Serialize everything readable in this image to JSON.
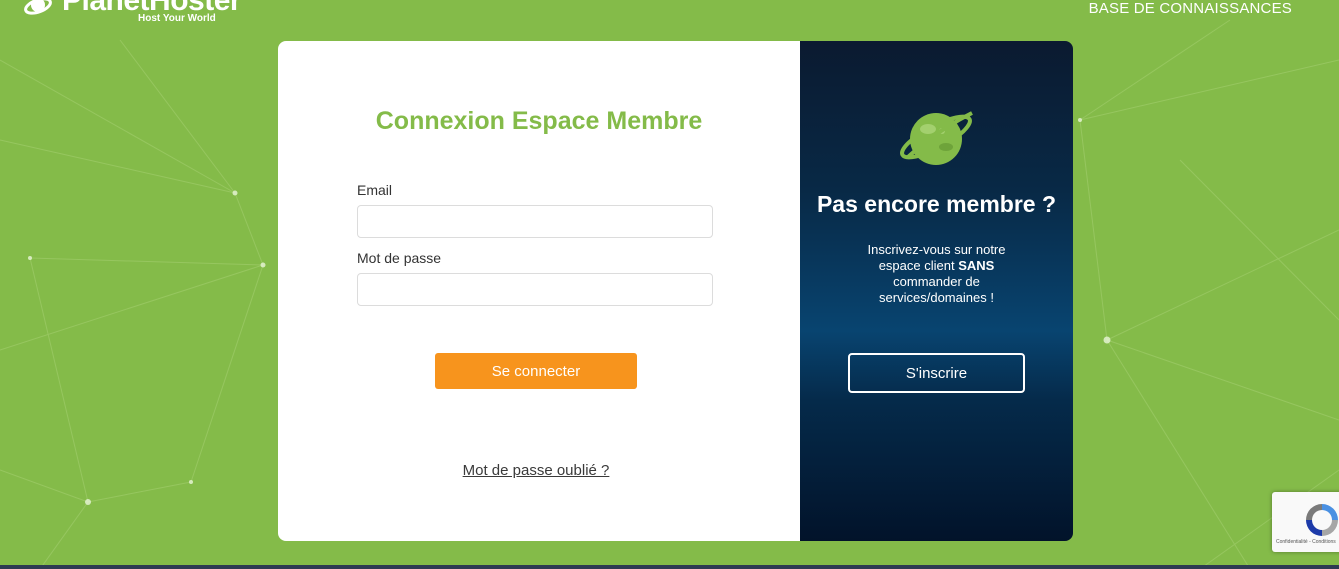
{
  "header": {
    "brand_name": "PlanetHoster",
    "brand_tagline": "Host Your World",
    "knowledge_base_link": "BASE DE CONNAISSANCES"
  },
  "login": {
    "title": "Connexion Espace Membre",
    "email_label": "Email",
    "email_value": "",
    "email_placeholder": "",
    "password_label": "Mot de passe",
    "password_value": "",
    "password_placeholder": "",
    "submit_label": "Se connecter",
    "forgot_password_link": "Mot de passe oublié ?"
  },
  "signup": {
    "title": "Pas encore membre ?",
    "text_before_bold": "Inscrivez-vous sur notre espace client ",
    "text_bold": "SANS",
    "text_after_bold": " commander de services/domaines !",
    "button_label": "S'inscrire"
  },
  "recaptcha": {
    "links": "Confidentialité - Conditions"
  },
  "colors": {
    "background_green": "#84bb49",
    "title_green": "#84bb49",
    "button_orange": "#f7941d",
    "panel_dark_blue": "#082946"
  },
  "icons": [
    "planet-logo-icon",
    "planet-illustration-icon",
    "recaptcha-icon"
  ]
}
